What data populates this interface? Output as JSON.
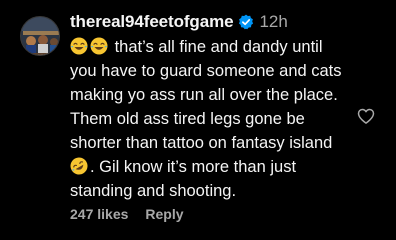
{
  "comment": {
    "username": "thereal94feetofgame",
    "verified": true,
    "time": "12h",
    "text_part1": " that’s all fine and dandy until you have to guard someone and cats making yo ass run all over the place. Them old ass tired legs gone be shorter than tattoo on fantasy island ",
    "text_part2": ". Gil know it’s more than just standing and shooting.",
    "leading_emoji": [
      "face-with-tears-of-joy",
      "face-with-tears-of-joy"
    ],
    "inline_emoji": "rolling-on-the-floor-laughing",
    "likes": "247 likes",
    "reply_label": "Reply"
  },
  "colors": {
    "background": "#000000",
    "text": "#f5f5f5",
    "muted": "#a8a8a8",
    "verified_badge": "#0095f6"
  }
}
